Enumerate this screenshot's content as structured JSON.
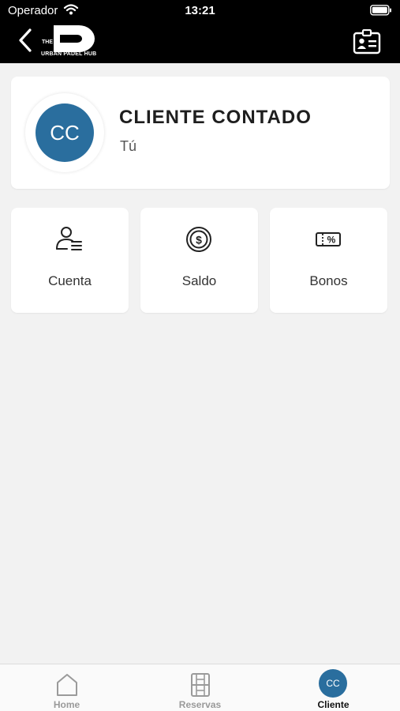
{
  "status_bar": {
    "carrier": "Operador",
    "time": "13:21"
  },
  "header": {
    "logo_top": "THE",
    "logo_text": "URBAN PADEL HUB",
    "back_icon": "chevron-left-icon",
    "card_icon": "id-card-icon"
  },
  "profile": {
    "initials": "CC",
    "name": "CLIENTE CONTADO",
    "subtitle": "Tú",
    "avatar_color": "#2a6e9e"
  },
  "tiles": [
    {
      "label": "Cuenta",
      "icon": "user-list-icon"
    },
    {
      "label": "Saldo",
      "icon": "coin-icon"
    },
    {
      "label": "Bonos",
      "icon": "ticket-percent-icon"
    }
  ],
  "tabbar": {
    "tabs": [
      {
        "label": "Home",
        "icon": "home-icon"
      },
      {
        "label": "Reservas",
        "icon": "court-icon"
      },
      {
        "label": "Cliente",
        "initials": "CC"
      }
    ],
    "active": "Cliente"
  }
}
